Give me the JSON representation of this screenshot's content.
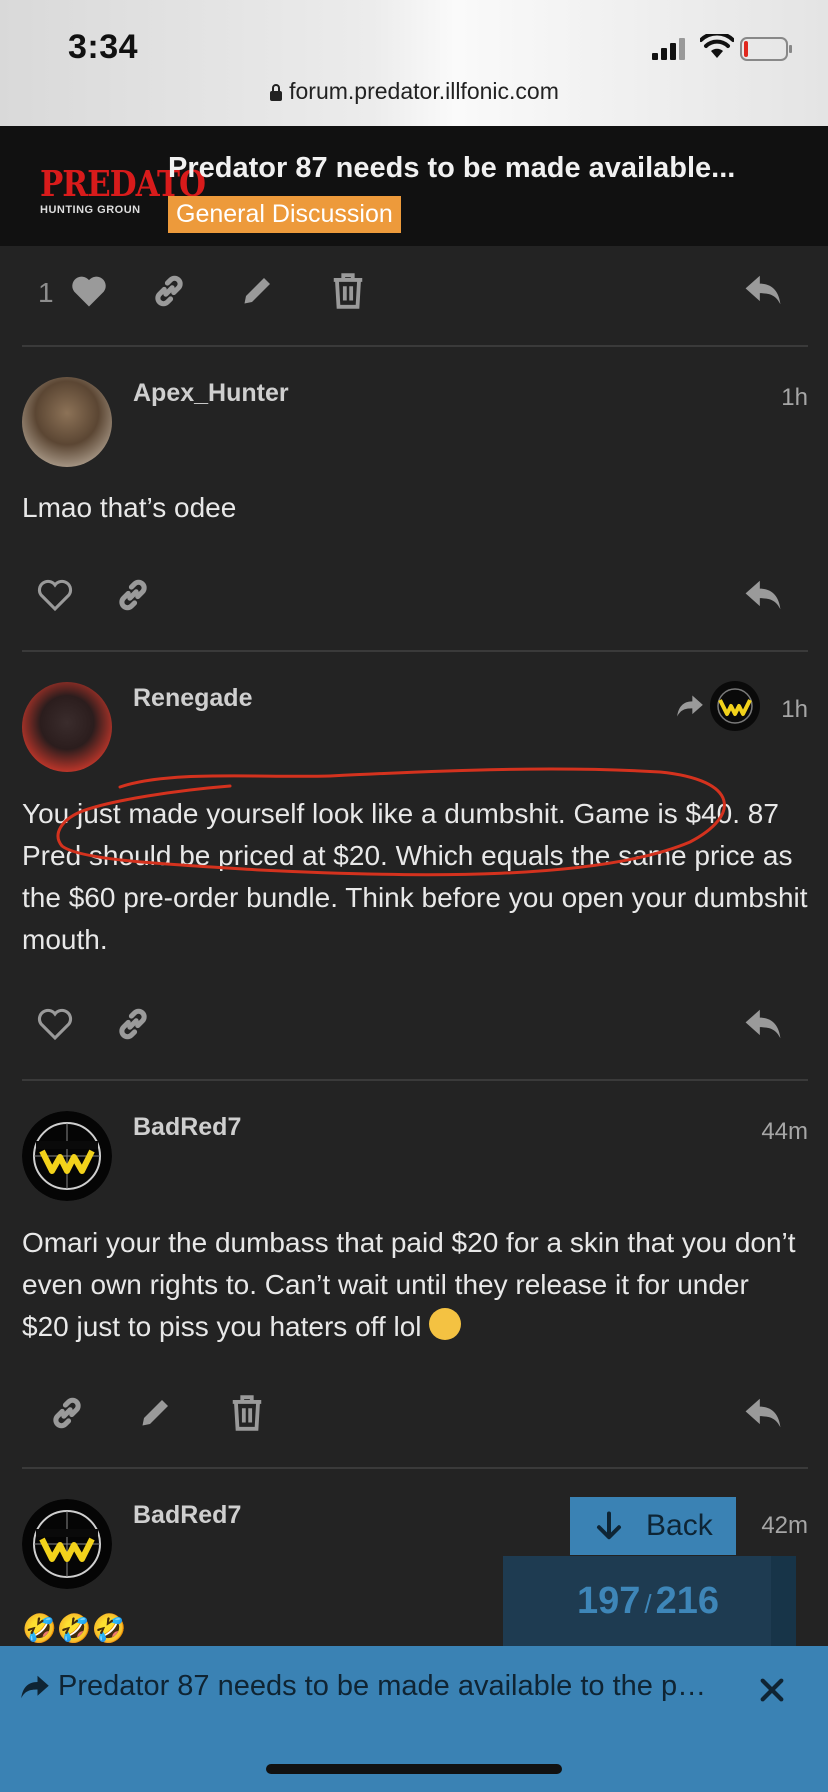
{
  "status_bar": {
    "time": "3:34",
    "url": "forum.predator.illfonic.com"
  },
  "header": {
    "logo_text": "PREDATO",
    "logo_subtext": "HUNTING GROUN",
    "topic_title": "Predator 87 needs to be made available...",
    "category": "General Discussion",
    "category_color": "#ed9a3b"
  },
  "prev_post_actions": {
    "like_count": "1"
  },
  "posts": [
    {
      "username": "Apex_Hunter",
      "time": "1h",
      "body": "Lmao that’s odee"
    },
    {
      "username": "Renegade",
      "time": "1h",
      "body": "You just made yourself look like a dumbshit. Game is $40. 87 Pred should be priced at $20. Which equals the same price as the $60 pre-order bundle. Think before you open your dumbshit mouth."
    },
    {
      "username": "BadRed7",
      "time": "44m",
      "body": "Omari your the dumbass that paid $20 for a skin that you don’t even own rights to. Can’t wait until they release it for under $20 just to piss you haters off lol"
    },
    {
      "username": "BadRed7",
      "time": "42m",
      "body": "🤣🤣🤣"
    }
  ],
  "back_button": {
    "label": "Back"
  },
  "progress": {
    "current": "197",
    "separator": "/",
    "total": "216"
  },
  "banner": {
    "text": "Predator 87 needs to be made available to the p…"
  },
  "colors": {
    "accent": "#3a82b4",
    "background": "#232323",
    "annotation": "#d4321e"
  }
}
